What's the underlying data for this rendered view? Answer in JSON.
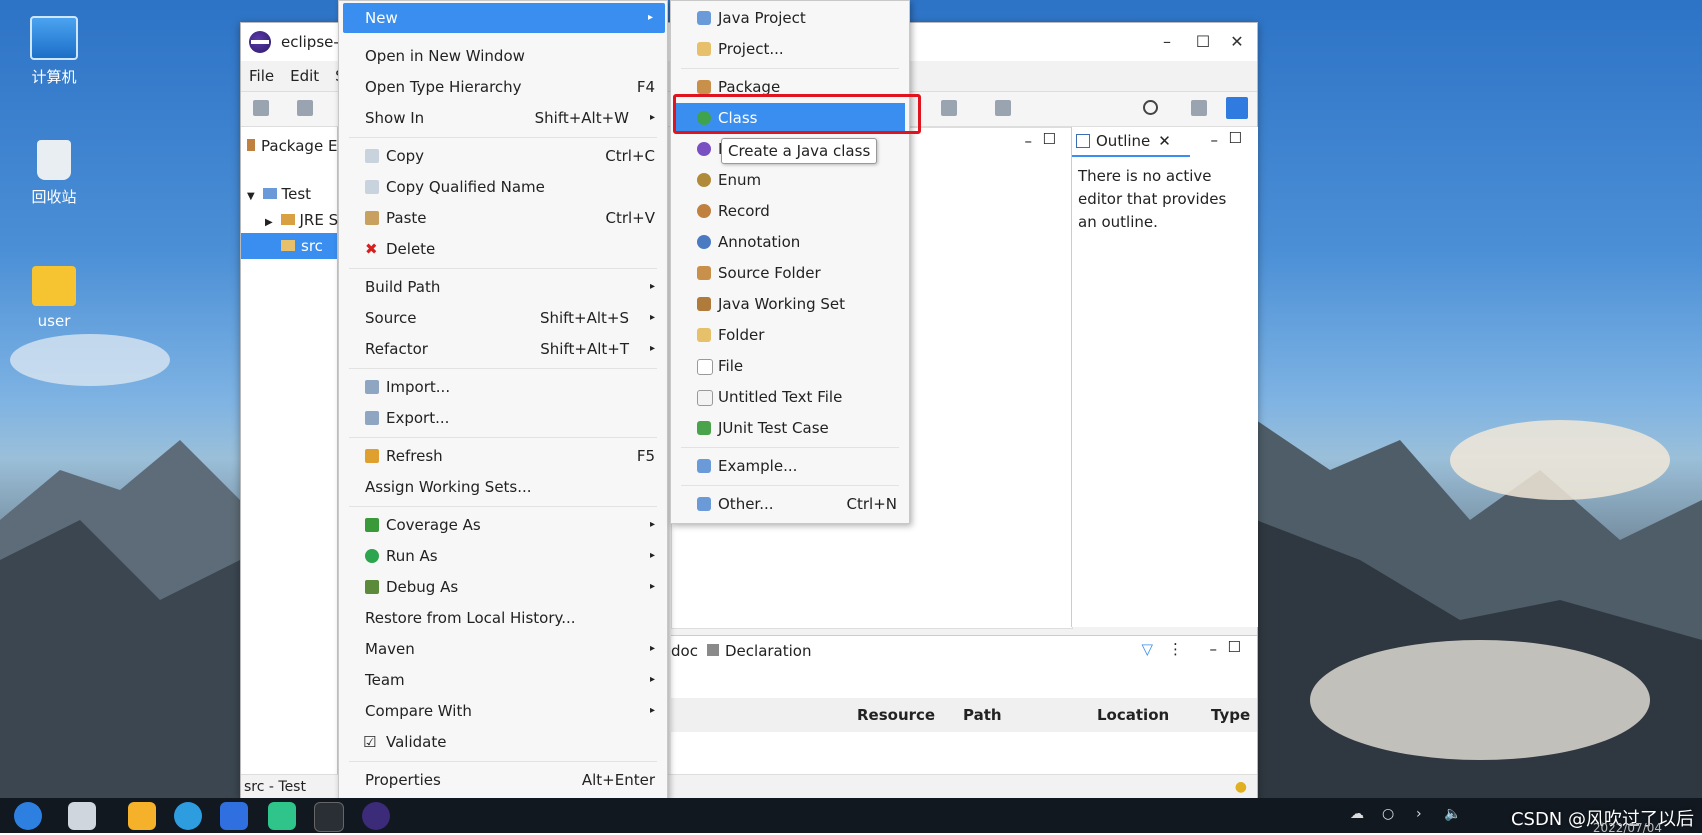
{
  "desktop": {
    "icons": [
      {
        "label": "计算机"
      },
      {
        "label": "回收站"
      },
      {
        "label": "user"
      }
    ]
  },
  "window": {
    "title": "eclipse-w",
    "menubar": [
      "File",
      "Edit",
      "S"
    ],
    "package_explorer": {
      "tab": "Package Ex",
      "tree": [
        {
          "label": "Test"
        },
        {
          "label": "JRE Sy"
        },
        {
          "label": "src"
        }
      ]
    },
    "outline": {
      "tab": "Outline",
      "message": "There is no active editor that provides an outline."
    },
    "bottom_panel": {
      "tabs": [
        "doc",
        "Declaration"
      ],
      "columns": [
        "Resource",
        "Path",
        "Location",
        "Type"
      ]
    },
    "status": "src - Test"
  },
  "context_menu": {
    "items": [
      {
        "label": "New",
        "arrow": "▸"
      },
      {
        "label": "Open in New Window"
      },
      {
        "label": "Open Type Hierarchy",
        "shortcut": "F4"
      },
      {
        "label": "Show In",
        "shortcut": "Shift+Alt+W",
        "arrow": "▸"
      },
      {
        "label": "Copy",
        "shortcut": "Ctrl+C",
        "icon": "copy-icon"
      },
      {
        "label": "Copy Qualified Name",
        "icon": "copy-qualified-icon"
      },
      {
        "label": "Paste",
        "shortcut": "Ctrl+V",
        "icon": "paste-icon"
      },
      {
        "label": "Delete",
        "icon": "delete-icon"
      },
      {
        "label": "Build Path",
        "arrow": "▸"
      },
      {
        "label": "Source",
        "shortcut": "Shift+Alt+S",
        "arrow": "▸"
      },
      {
        "label": "Refactor",
        "shortcut": "Shift+Alt+T",
        "arrow": "▸"
      },
      {
        "label": "Import...",
        "icon": "import-icon"
      },
      {
        "label": "Export...",
        "icon": "export-icon"
      },
      {
        "label": "Refresh",
        "shortcut": "F5",
        "icon": "refresh-icon"
      },
      {
        "label": "Assign Working Sets..."
      },
      {
        "label": "Coverage As",
        "arrow": "▸",
        "icon": "coverage-icon"
      },
      {
        "label": "Run As",
        "arrow": "▸",
        "icon": "run-icon"
      },
      {
        "label": "Debug As",
        "arrow": "▸",
        "icon": "debug-icon"
      },
      {
        "label": "Restore from Local History..."
      },
      {
        "label": "Maven",
        "arrow": "▸"
      },
      {
        "label": "Team",
        "arrow": "▸"
      },
      {
        "label": "Compare With",
        "arrow": "▸"
      },
      {
        "label": "Validate",
        "check": "☑"
      },
      {
        "label": "Properties",
        "shortcut": "Alt+Enter"
      }
    ]
  },
  "new_submenu": {
    "items": [
      {
        "label": "Java Project"
      },
      {
        "label": "Project..."
      },
      {
        "label": "Package"
      },
      {
        "label": "Class"
      },
      {
        "label": "I"
      },
      {
        "label": "Enum"
      },
      {
        "label": "Record"
      },
      {
        "label": "Annotation"
      },
      {
        "label": "Source Folder"
      },
      {
        "label": "Java Working Set"
      },
      {
        "label": "Folder"
      },
      {
        "label": "File"
      },
      {
        "label": "Untitled Text File"
      },
      {
        "label": "JUnit Test Case"
      },
      {
        "label": "Example..."
      },
      {
        "label": "Other...",
        "shortcut": "Ctrl+N"
      }
    ],
    "tooltip": "Create a Java class"
  },
  "taskbar": {
    "watermark": "CSDN @风吹过了以后",
    "clock": "2022/07/04"
  },
  "colors": {
    "highlight": "#3a8ef0",
    "annotation_box": "#e0141e"
  }
}
